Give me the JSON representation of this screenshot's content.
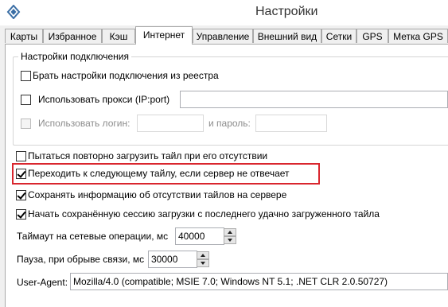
{
  "window": {
    "title": "Настройки"
  },
  "tabs": [
    {
      "label": "Карты",
      "active": false
    },
    {
      "label": "Избранное",
      "active": false
    },
    {
      "label": "Кэш",
      "active": false
    },
    {
      "label": "Интернет",
      "active": true
    },
    {
      "label": "Управление",
      "active": false
    },
    {
      "label": "Внешний вид",
      "active": false
    },
    {
      "label": "Сетки",
      "active": false
    },
    {
      "label": "GPS",
      "active": false
    },
    {
      "label": "Метка GPS",
      "active": false
    }
  ],
  "connection": {
    "group_title": "Настройки подключения",
    "use_registry": {
      "label": "Брать настройки подключения из реестра",
      "checked": false
    },
    "use_proxy": {
      "label": "Использовать прокси (IP:port)",
      "checked": false,
      "value": ""
    },
    "use_login": {
      "label": "Использовать логин:",
      "checked": false,
      "enabled": false,
      "login_value": ""
    },
    "password_label": "и пароль:",
    "password_value": ""
  },
  "options": {
    "retry_missing": {
      "label": "Пытаться повторно загрузить тайл при его отсутствии",
      "checked": false
    },
    "next_tile": {
      "label": "Переходить к следующему тайлу, если сервер не отвечает",
      "checked": true
    },
    "save_missing_info": {
      "label": "Сохранять информацию об отсутствии тайлов на сервере",
      "checked": true
    },
    "resume_session": {
      "label": "Начать сохранённую сессию загрузки с последнего удачно загруженного тайла",
      "checked": true
    }
  },
  "timeout": {
    "label": "Таймаут на сетевые операции, мс",
    "value": "40000"
  },
  "pause": {
    "label": "Пауза, при обрыве связи, мс",
    "value": "30000"
  },
  "user_agent": {
    "label": "User-Agent:",
    "value": "Mozilla/4.0 (compatible; MSIE 7.0; Windows NT 5.1; .NET CLR 2.0.50727)"
  },
  "colors": {
    "highlight": "#d9262e"
  }
}
